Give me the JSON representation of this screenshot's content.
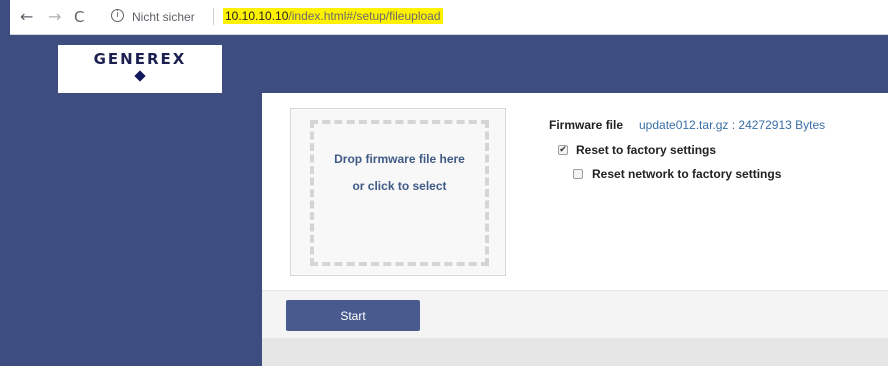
{
  "browser": {
    "back_glyph": "←",
    "forward_glyph": "→",
    "reload_glyph": "C",
    "info_glyph": "i",
    "security_label": "Nicht sicher",
    "url_host": "10.10.10.10",
    "url_path": "/index.html#/setup/fileupload"
  },
  "header": {
    "logo_text": "GENEREX"
  },
  "dropzone": {
    "line1": "Drop firmware file here",
    "line2": "or click to select"
  },
  "firmware": {
    "label": "Firmware file",
    "value": "update012.tar.gz : 24272913 Bytes"
  },
  "options": {
    "factory": {
      "label": "Reset to factory settings",
      "checked": true,
      "mark": "✔"
    },
    "network": {
      "label": "Reset network to factory settings",
      "checked": false,
      "mark": ""
    }
  },
  "actions": {
    "start_label": "Start"
  },
  "colors": {
    "brand_navy": "#3e4d7f",
    "button": "#495a8f",
    "link_blue": "#3a6fa5",
    "url_highlight": "#fff200"
  },
  "icons": {
    "back": "arrow-left-icon",
    "forward": "arrow-right-icon",
    "reload": "reload-icon",
    "info": "info-icon",
    "logo_mark": "diamond-icon"
  }
}
